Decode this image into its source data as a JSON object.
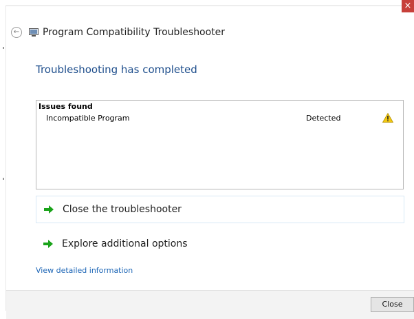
{
  "window": {
    "title": "Program Compatibility Troubleshooter",
    "close_glyph": "×"
  },
  "icons": {
    "back": "back-arrow-icon",
    "app": "troubleshooter-app-icon",
    "warning": "warning-icon",
    "option_arrow": "green-arrow-icon"
  },
  "main": {
    "heading": "Troubleshooting has completed",
    "issues": {
      "header": "Issues found",
      "rows": [
        {
          "name": "Incompatible Program",
          "status": "Detected"
        }
      ]
    },
    "options": [
      {
        "label": "Close the troubleshooter"
      },
      {
        "label": "Explore additional options"
      }
    ],
    "details_link": "View detailed information"
  },
  "footer": {
    "close_label": "Close"
  },
  "colors": {
    "heading": "#1e4e8c",
    "link": "#1d66b6",
    "close_x_bg": "#c7403a",
    "arrow": "#1aa31a",
    "warning": "#f2c811"
  }
}
